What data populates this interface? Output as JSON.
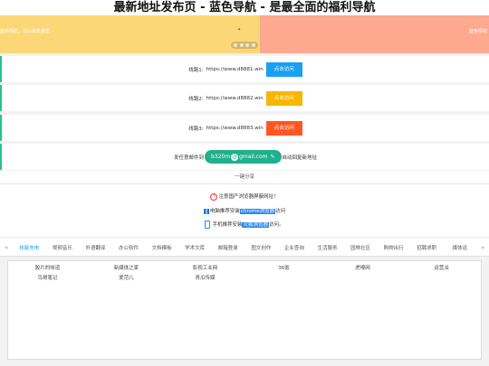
{
  "page": {
    "title": "最新地址发布页 - 蓝色导航 - 是最全面的福利导航"
  },
  "banner": {
    "left_text": "蓝色导航，找么就去那里",
    "right_text": "蓝色导航",
    "sparkle": "✦"
  },
  "lines": [
    {
      "label": "线路1:",
      "url": "https://www.d8881.win",
      "button": "点击访问",
      "color": "#1aa0f0"
    },
    {
      "label": "线路2:",
      "url": "https://www.d8882.win",
      "button": "点击访问",
      "color": "#f8b600"
    },
    {
      "label": "线路3:",
      "url": "https://www.d8883.win",
      "button": "点击访问",
      "color": "#ff5722"
    }
  ],
  "email": {
    "prefix": "发任意邮件到",
    "user": "b320m",
    "domain": "gmail.com",
    "suffix": "自动回复新地址"
  },
  "share": {
    "label": "一键分享"
  },
  "notice": {
    "line1": "注意国产浏览器屏蔽网址！",
    "line2_pre": "电脑推荐安装",
    "line2_hl": "chrome浏览器",
    "line2_post": "访问",
    "line3_pre": "手机推荐安装",
    "line3_hl": "火狐浏览器",
    "line3_post": "访问。"
  },
  "tabs": {
    "prev": "«",
    "next": "»",
    "items": [
      "技能充电",
      "视频音乐",
      "外语翻译",
      "办公软件",
      "文档模板",
      "学术文库",
      "邮箱登录",
      "图文创作",
      "企业查询",
      "生活服务",
      "园林社区",
      "购物出行",
      "招聘求职",
      "媒体运"
    ],
    "active": 0
  },
  "links": {
    "row1": [
      "胶片的味道",
      "新媒体之家",
      "影视工业网",
      "36氪",
      "虎嗅网",
      "运营派"
    ],
    "row2": [
      "鸟哥笔记",
      "爱范儿",
      "青瓜传媒"
    ]
  }
}
